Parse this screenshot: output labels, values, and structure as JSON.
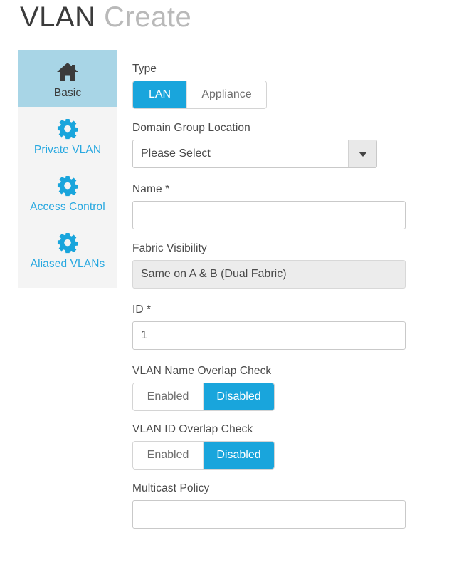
{
  "header": {
    "title_primary": "VLAN",
    "title_secondary": "Create"
  },
  "sidebar": {
    "items": [
      {
        "label": "Basic",
        "icon": "home-icon",
        "active": true
      },
      {
        "label": "Private VLAN",
        "icon": "gear-icon",
        "active": false
      },
      {
        "label": "Access Control",
        "icon": "gear-icon",
        "active": false
      },
      {
        "label": "Aliased VLANs",
        "icon": "gear-icon",
        "active": false
      }
    ]
  },
  "form": {
    "type": {
      "label": "Type",
      "options": [
        "LAN",
        "Appliance"
      ],
      "selected": "LAN"
    },
    "domain_group_location": {
      "label": "Domain Group Location",
      "value": "Please Select"
    },
    "name": {
      "label": "Name",
      "required_marker": "*",
      "value": "",
      "placeholder": ""
    },
    "fabric_visibility": {
      "label": "Fabric Visibility",
      "value": "Same on A & B (Dual Fabric)"
    },
    "id": {
      "label": "ID",
      "required_marker": "*",
      "value": "1",
      "placeholder": ""
    },
    "vlan_name_overlap_check": {
      "label": "VLAN Name Overlap Check",
      "options": [
        "Enabled",
        "Disabled"
      ],
      "selected": "Disabled"
    },
    "vlan_id_overlap_check": {
      "label": "VLAN ID Overlap Check",
      "options": [
        "Enabled",
        "Disabled"
      ],
      "selected": "Disabled"
    },
    "multicast_policy": {
      "label": "Multicast Policy",
      "value": "",
      "placeholder": ""
    }
  },
  "colors": {
    "accent_blue": "#19a5dc",
    "active_tab_bg": "#a8d5e6",
    "sidebar_bg": "#f4f4f4",
    "link_blue": "#28a8e0"
  }
}
